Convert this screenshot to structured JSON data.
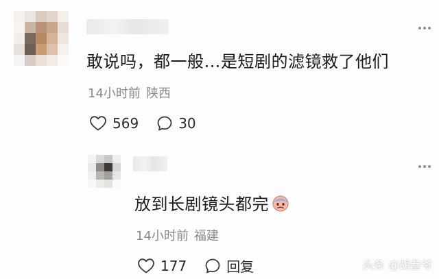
{
  "comment": {
    "text": "敢说吗，都一般…是短剧的滤镜救了他们",
    "time": "14小时前",
    "location": "陕西",
    "likes": "569",
    "replies": "30"
  },
  "reply": {
    "text": "放到长剧镜头都完",
    "emoji": "face-with-cold-sweat-icon",
    "time": "14小时前",
    "location": "福建",
    "likes": "177",
    "reply_label": "回复"
  },
  "watermark": "头条 @胡叁爷",
  "colors": {
    "text": "#1b1b1b",
    "meta": "#8a8a8a",
    "icon": "#3a3a3a"
  }
}
